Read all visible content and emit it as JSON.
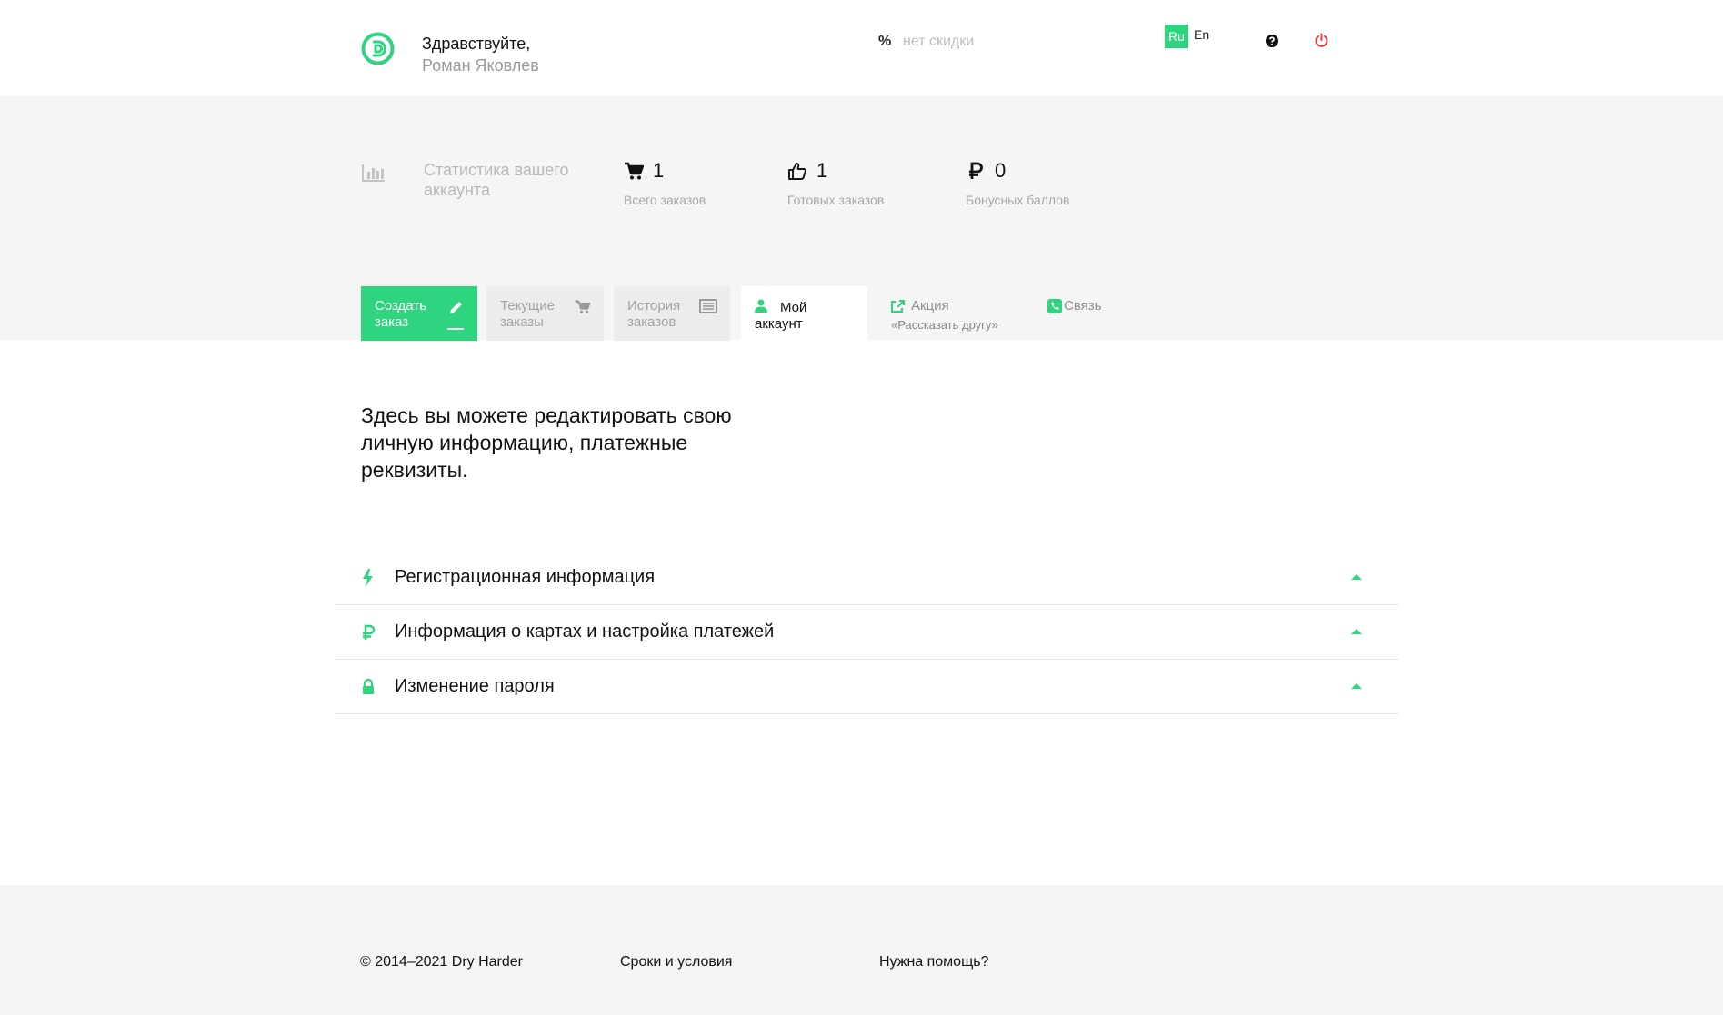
{
  "header": {
    "greeting": "Здравствуйте,",
    "user_name": "Роман Яковлев",
    "discount_symbol": "%",
    "discount_text": "нет скидки",
    "languages": {
      "active": "Ru",
      "other": "En"
    },
    "icons": [
      "logo-icon",
      "help-icon",
      "power-icon"
    ]
  },
  "stats": {
    "title": "Статистика вашего аккаунта",
    "items": [
      {
        "value": "1",
        "caption": "Всего заказов",
        "icon": "cart-icon"
      },
      {
        "value": "1",
        "caption": "Готовых заказов",
        "icon": "thumbs-up-icon"
      },
      {
        "value": "0",
        "caption": "Бонусных баллов",
        "icon": "ruble-icon"
      }
    ]
  },
  "tabs": [
    {
      "label": "Создать заказ",
      "icon": "pencil-icon",
      "state": "primary"
    },
    {
      "label": "Текущие заказы",
      "icon": "cart-icon",
      "state": "inactive"
    },
    {
      "label": "История заказов",
      "icon": "list-icon",
      "state": "inactive"
    },
    {
      "label": "Мой аккаунт",
      "icon": "user-icon",
      "state": "active"
    },
    {
      "label": "Акция",
      "sublabel": "«Рассказать другу»",
      "icon": "share-icon",
      "state": "link"
    },
    {
      "label": "Связь",
      "icon": "phone-icon",
      "state": "link"
    }
  ],
  "main": {
    "intro": "Здесь вы можете редактировать свою личную информацию, платежные реквизиты.",
    "sections": [
      {
        "title": "Регистрационная информация",
        "icon": "bolt-icon"
      },
      {
        "title": "Информация о картах и настройка платежей",
        "icon": "ruble-icon"
      },
      {
        "title": "Изменение пароля",
        "icon": "lock-icon"
      }
    ]
  },
  "footer": {
    "copyright": "© 2014–2021 Dry Harder",
    "terms": "Сроки и условия",
    "help": "Нужна помощь?"
  },
  "colors": {
    "accent": "#2ed47e",
    "danger": "#e8383d",
    "band": "#f5f5f5"
  }
}
